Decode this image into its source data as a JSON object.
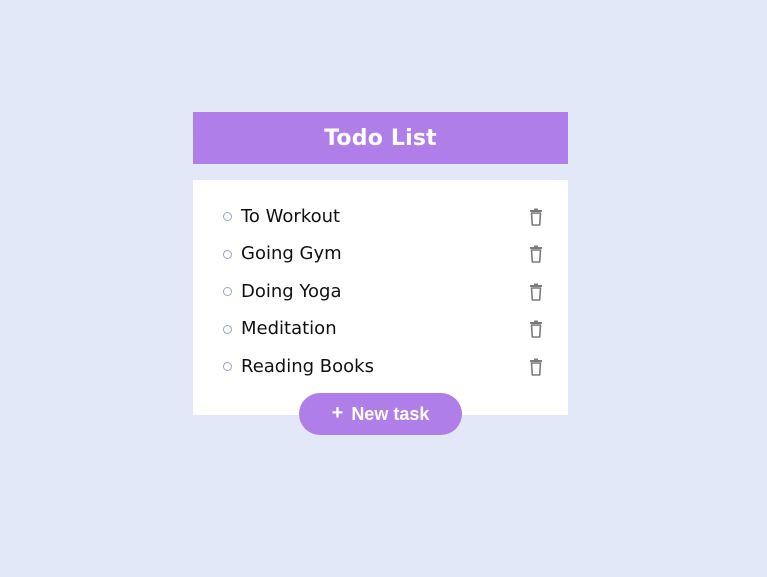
{
  "app": {
    "title": "Todo List"
  },
  "tasks": [
    {
      "label": "To Workout"
    },
    {
      "label": "Going Gym"
    },
    {
      "label": "Doing Yoga"
    },
    {
      "label": "Meditation"
    },
    {
      "label": "Reading Books"
    }
  ],
  "actions": {
    "new_task_label": "New task",
    "plus_glyph": "+"
  },
  "colors": {
    "background": "#e3e8f8",
    "accent": "#b07ee9",
    "card": "#ffffff",
    "text": "#111111",
    "trash_icon": "#7b7b7b",
    "radio_border": "#9aa6c1"
  },
  "icons": {
    "delete": "trash-icon",
    "checkbox": "radio-icon",
    "add": "plus-icon"
  }
}
